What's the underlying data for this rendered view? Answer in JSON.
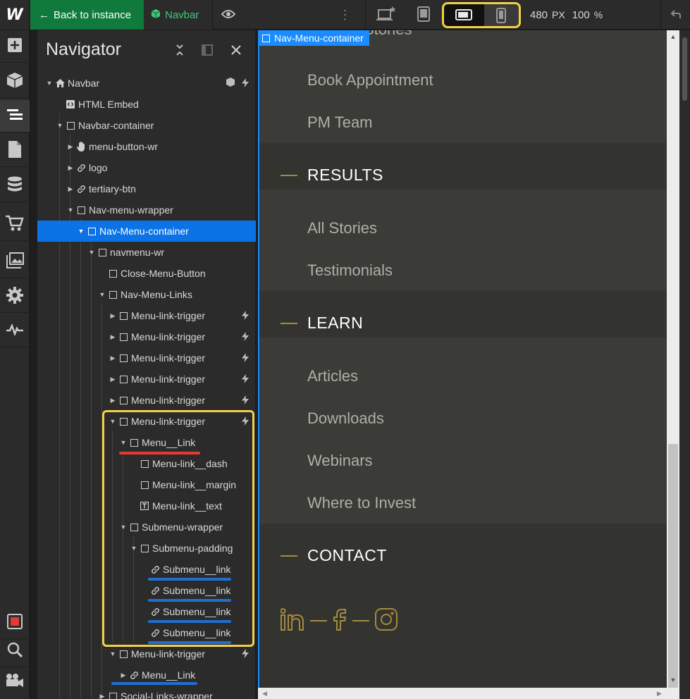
{
  "topbar": {
    "back_label": "Back to instance",
    "symbol_label": "Navbar",
    "more_glyph": "⋮",
    "width_value": "480",
    "width_unit": "PX",
    "zoom_value": "100",
    "zoom_unit": "%",
    "active_breakpoint": "mobile-landscape"
  },
  "rail": {
    "items": [
      "add-icon",
      "cube-icon",
      "navigator-icon",
      "page-icon",
      "cms-icon",
      "ecommerce-icon",
      "assets-icon",
      "settings-icon",
      "activity-icon",
      "record-icon",
      "search-icon",
      "video-icon"
    ],
    "active": "navigator-icon"
  },
  "navigator": {
    "title": "Navigator",
    "tree": [
      {
        "label": "Navbar"
      },
      {
        "label": "HTML Embed"
      },
      {
        "label": "Navbar-container"
      },
      {
        "label": "menu-button-wr"
      },
      {
        "label": "logo"
      },
      {
        "label": "tertiary-btn"
      },
      {
        "label": "Nav-menu-wrapper"
      },
      {
        "label": "Nav-Menu-container"
      },
      {
        "label": "navmenu-wr"
      },
      {
        "label": "Close-Menu-Button"
      },
      {
        "label": "Nav-Menu-Links"
      },
      {
        "label": "Menu-link-trigger"
      },
      {
        "label": "Menu-link-trigger"
      },
      {
        "label": "Menu-link-trigger"
      },
      {
        "label": "Menu-link-trigger"
      },
      {
        "label": "Menu-link-trigger"
      },
      {
        "label": "Menu-link-trigger"
      },
      {
        "label": "Menu__Link"
      },
      {
        "label": "Menu-link__dash"
      },
      {
        "label": "Menu-link__margin"
      },
      {
        "label": "Menu-link__text"
      },
      {
        "label": "Submenu-wrapper"
      },
      {
        "label": "Submenu-padding"
      },
      {
        "label": "Submenu__link"
      },
      {
        "label": "Submenu__link"
      },
      {
        "label": "Submenu__link"
      },
      {
        "label": "Submenu__link"
      },
      {
        "label": "Menu-link-trigger"
      },
      {
        "label": "Menu__Link"
      },
      {
        "label": "Social-Links-wrapper"
      }
    ]
  },
  "canvas": {
    "selected_label": "Nav-Menu-container",
    "partial_top_text": "Stories",
    "sections": [
      {
        "type": "sub",
        "label": "Book Appointment"
      },
      {
        "type": "sub",
        "label": "PM Team"
      },
      {
        "type": "cat",
        "label": "RESULTS"
      },
      {
        "type": "sub",
        "label": "All Stories"
      },
      {
        "type": "sub",
        "label": "Testimonials"
      },
      {
        "type": "cat",
        "label": "LEARN"
      },
      {
        "type": "sub",
        "label": "Articles"
      },
      {
        "type": "sub",
        "label": "Downloads"
      },
      {
        "type": "sub",
        "label": "Webinars"
      },
      {
        "type": "sub",
        "label": "Where to Invest"
      },
      {
        "type": "cat",
        "label": "CONTACT"
      }
    ],
    "social": [
      "linkedin-icon",
      "facebook-icon",
      "instagram-icon"
    ]
  },
  "colors": {
    "accent_green": "#0f7a3c",
    "selection_blue": "#0c73e6",
    "highlight_yellow": "#f2cf45",
    "gold": "#a68a3c",
    "underline_red": "#e53935",
    "underline_blue": "#1f6fd1"
  }
}
